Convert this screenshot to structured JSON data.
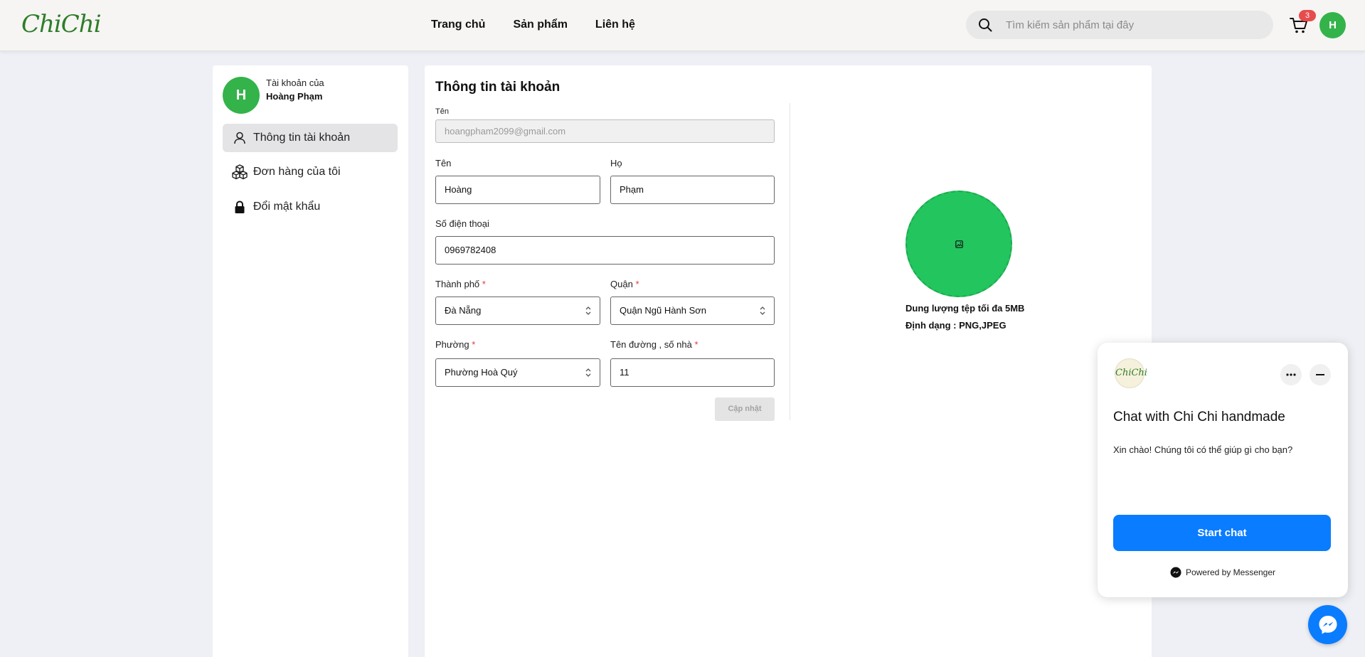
{
  "header": {
    "logo_text": "ChiChi",
    "nav": [
      "Trang chủ",
      "Sản phẩm",
      "Liên hệ"
    ],
    "search_placeholder": "Tìm kiếm sản phẩm tại đây",
    "cart_count": "3",
    "avatar_initial": "H"
  },
  "sidebar": {
    "avatar_initial": "H",
    "owner_label": "Tài khoản của",
    "owner_name": "Hoàng Phạm",
    "items": [
      {
        "label": "Thông tin tài khoản",
        "icon": "user-icon",
        "active": true
      },
      {
        "label": "Đơn hàng của tôi",
        "icon": "boxes-icon",
        "active": false
      },
      {
        "label": "Đổi mật khẩu",
        "icon": "lock-icon",
        "active": false
      }
    ]
  },
  "main": {
    "title": "Thông tin tài khoản",
    "form": {
      "email_label": "Tên",
      "email_value": "hoangpham2099@gmail.com",
      "first_name_label": "Tên",
      "first_name_value": "Hoàng",
      "last_name_label": "Họ",
      "last_name_value": "Phạm",
      "phone_label": "Số điện thoại",
      "phone_value": "0969782408",
      "city_label": "Thành phố",
      "city_value": "Đà Nẵng",
      "district_label": "Quận",
      "district_value": "Quận Ngũ Hành Sơn",
      "ward_label": "Phường",
      "ward_value": "Phường Hoà Quý",
      "street_label": "Tên đường , số nhà",
      "street_value": "11",
      "required_mark": "*",
      "update_button": "Cập nhật"
    },
    "upload": {
      "max_size_note": "Dung lượng tệp tối đa 5MB",
      "format_note": "Định dạng : PNG,JPEG"
    }
  },
  "chat": {
    "logo_text": "ChiChi",
    "title": "Chat with Chi Chi handmade",
    "greeting": "Xin chào! Chúng tôi có thể giúp gì cho bạn?",
    "start_button": "Start chat",
    "powered_by": "Powered by Messenger"
  },
  "colors": {
    "brand_green": "#34b34a",
    "upload_green": "#22c55e",
    "messenger_blue": "#0a7cff",
    "badge_red": "#e74c4c",
    "logo_green": "#2f7d2a"
  }
}
